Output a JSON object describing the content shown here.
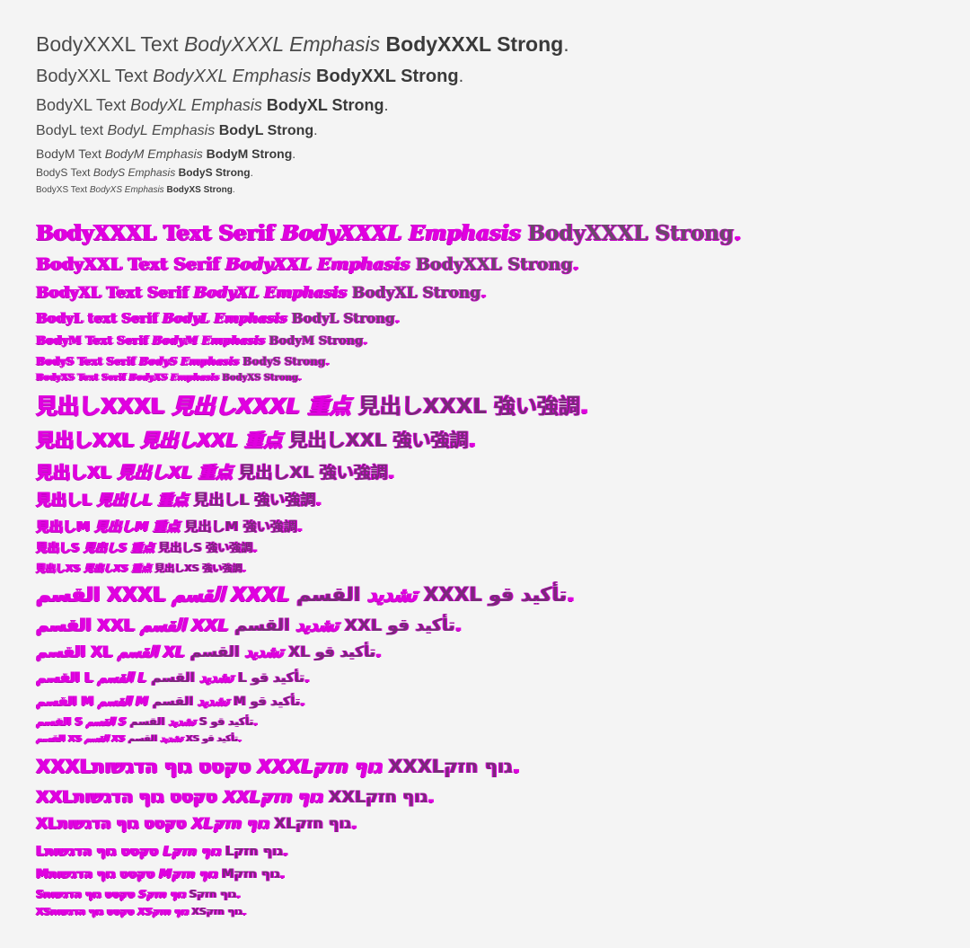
{
  "sans_rows": [
    {
      "text": "BodyXXXL Text ",
      "emph": "BodyXXXL Emphasis",
      "strong": "BodyXXXL Strong",
      "end": "."
    },
    {
      "text": "BodyXXL Text ",
      "emph": "BodyXXL Emphasis",
      "strong": "BodyXXL Strong",
      "end": "."
    },
    {
      "text": "BodyXL Text ",
      "emph": "BodyXL Emphasis",
      "strong": "BodyXL Strong",
      "end": "."
    },
    {
      "text": "BodyL text ",
      "emph": "BodyL Emphasis",
      "strong": "BodyL Strong",
      "end": "."
    },
    {
      "text": "BodyM Text ",
      "emph": "BodyM Emphasis",
      "strong": "BodyM Strong",
      "end": "."
    },
    {
      "text": "BodyS Text ",
      "emph": "BodyS Emphasis",
      "strong": "BodyS Strong",
      "end": "."
    },
    {
      "text": "BodyXS Text ",
      "emph": "BodyXS Emphasis",
      "strong": "BodyXS Strong",
      "end": "."
    }
  ],
  "serif_rows": [
    {
      "text": "BodyXXXL Text Serif ",
      "emph": "BodyXXXL Emphasis",
      "strong": "BodyXXXL Strong",
      "end": "."
    },
    {
      "text": "BodyXXL Text Serif ",
      "emph": "BodyXXL Emphasis",
      "strong": "BodyXXL Strong",
      "end": "."
    },
    {
      "text": "BodyXL Text Serif ",
      "emph": "BodyXL Emphasis",
      "strong": "BodyXL Strong",
      "end": "."
    },
    {
      "text": "BodyL text Serif ",
      "emph": "BodyL Emphasis",
      "strong": "BodyL Strong",
      "end": "."
    },
    {
      "text": "BodyM Text Serif ",
      "emph": "BodyM Emphasis",
      "strong": "BodyM Strong",
      "end": "."
    },
    {
      "text": "BodyS Text Serif ",
      "emph": "BodyS Emphasis",
      "strong": "BodyS Strong",
      "end": "."
    },
    {
      "text": "BodyXS Text Serif ",
      "emph": "BodyXS Emphasis",
      "strong": "BodyXS Strong",
      "end": "."
    }
  ],
  "cjk_rows": [
    {
      "text": "見出しXXXL ",
      "emph": "見出しXXXL 重点",
      "strong": "見出しXXXL 強い強調",
      "end": "."
    },
    {
      "text": "見出しXXL ",
      "emph": "見出しXXL 重点",
      "strong": "見出しXXL 強い強調",
      "end": "."
    },
    {
      "text": "見出しXL ",
      "emph": "見出しXL 重点",
      "strong": "見出しXL 強い強調",
      "end": "."
    },
    {
      "text": "見出しL ",
      "emph": "見出しL 重点",
      "strong": "見出しL 強い強調",
      "end": "."
    },
    {
      "text": "見出しM ",
      "emph": "見出しM 重点",
      "strong": "見出しM 強い強調",
      "end": "."
    },
    {
      "text": "見出しS ",
      "emph": "見出しS 重点",
      "strong": "見出しS 強い強調",
      "end": "."
    },
    {
      "text": "見出しXS ",
      "emph": "見出しXS 重点",
      "strong": "見出しXS 強い強調",
      "end": "."
    }
  ],
  "arabic_rows": [
    {
      "text": "القسم XXXL ",
      "emph": "القسم XXXL تشديد",
      "strong": "القسم XXXL تأكيد قو",
      "end": "."
    },
    {
      "text": "القسم XXL ",
      "emph": "القسم XXL تشديد",
      "strong": "القسم XXL تأكيد قو",
      "end": "."
    },
    {
      "text": "القسم XL ",
      "emph": "القسم XL تشديد",
      "strong": "القسم XL تأكيد قو",
      "end": "."
    },
    {
      "text": "القسم L ",
      "emph": "القسم L تشديد",
      "strong": "القسم L تأكيد قو",
      "end": "."
    },
    {
      "text": "القسم M ",
      "emph": "القسم M تشديد",
      "strong": "القسم M تأكيد قو",
      "end": "."
    },
    {
      "text": "القسم S ",
      "emph": "القسم S تشديد",
      "strong": "القسم S تأكيد قو",
      "end": "."
    },
    {
      "text": "القسم XS ",
      "emph": "القسم XS تشديد",
      "strong": "القسم XS تأكيد قو",
      "end": "."
    }
  ],
  "hebrew_rows": [
    {
      "text": "XXXLטקסט גוף הדגשות ",
      "emph": "XXXLגוף חזק",
      "strong": "XXXLגוף חזק",
      "end": "."
    },
    {
      "text": "XXLטקסט גוף הדגשות ",
      "emph": "XXLגוף חזק",
      "strong": "XXLגוף חזק",
      "end": "."
    },
    {
      "text": "XLטקסט גוף הדגשות ",
      "emph": "XLגוף חזק",
      "strong": "XLגוף חזק",
      "end": "."
    },
    {
      "text": "Lטקסט גוף הדגשות ",
      "emph": "Lגוף חזק",
      "strong": "Lגוף חזק",
      "end": "."
    },
    {
      "text": "Mטקסט גוף הדגשות ",
      "emph": "Mגוף חזק",
      "strong": "Mגוף חזק",
      "end": "."
    },
    {
      "text": "Sטקסט גוף הדגשות ",
      "emph": "Sגוף חזק",
      "strong": "Sגוף חזק",
      "end": "."
    },
    {
      "text": "XSטקסט גוף הדגשות ",
      "emph": "XSגוף חזק",
      "strong": "XSגוף חזק",
      "end": "."
    }
  ]
}
